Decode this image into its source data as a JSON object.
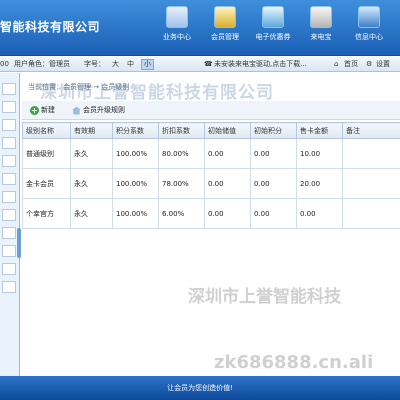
{
  "header": {
    "company": "智能科技有限公司",
    "nav": [
      {
        "label": "业务中心",
        "icon": "business-center-icon"
      },
      {
        "label": "会员管理",
        "icon": "member-manage-icon"
      },
      {
        "label": "电子优惠券",
        "icon": "coupon-icon"
      },
      {
        "label": "来电宝",
        "icon": "caller-phone-icon"
      },
      {
        "label": "信息中心",
        "icon": "info-center-icon"
      }
    ]
  },
  "userbar": {
    "prefix": "00",
    "user_role": "用户角色：管理员",
    "font_label": "字号：",
    "font_large": "大",
    "font_mid": "中",
    "font_small": "小",
    "notice": "未安装来电宝驱动,点击下载...",
    "home": "首页",
    "settings": "设置"
  },
  "breadcrumb": "当前位置：会员管理 → 会员级别",
  "toolbar": {
    "new_label": "新建",
    "upgrade_label": "会员升级规则"
  },
  "table": {
    "headers": [
      "级别名称",
      "有效期",
      "积分系数",
      "折扣系数",
      "初始储值",
      "初始积分",
      "售卡金额",
      "备注"
    ],
    "rows": [
      [
        "普通级别",
        "永久",
        "100.00%",
        "80.00%",
        "0.00",
        "0.00",
        "10.00",
        ""
      ],
      [
        "金卡会员",
        "永久",
        "100.00%",
        "78.00%",
        "0.00",
        "0.00",
        "20.00",
        ""
      ],
      [
        "个幸官方",
        "永久",
        "100.00%",
        "6.00%",
        "0.00",
        "0.00",
        "0.00",
        ""
      ]
    ]
  },
  "watermarks": {
    "top": "深圳市上誉智能科技有限公司",
    "middle": "深圳市上誉智能科技",
    "bottom": "zk686888.cn.ali"
  },
  "footer": "让会员为您创造价值!"
}
